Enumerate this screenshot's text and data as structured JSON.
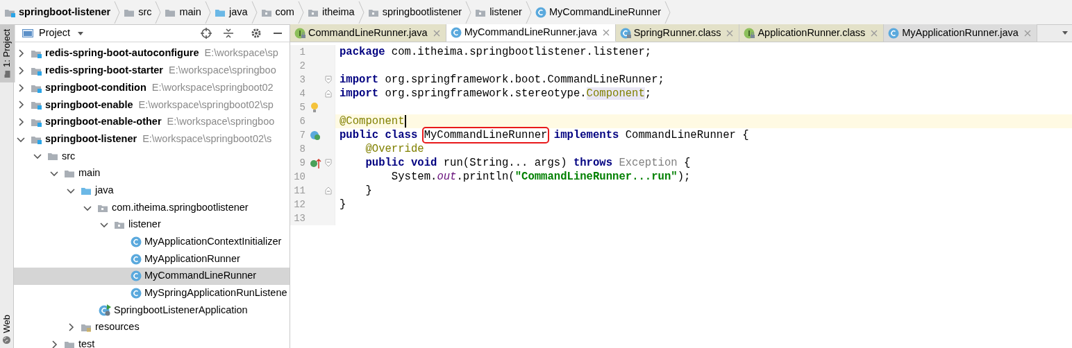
{
  "breadcrumbs": [
    {
      "label": "springboot-listener",
      "kind": "module"
    },
    {
      "label": "src",
      "kind": "folder"
    },
    {
      "label": "main",
      "kind": "folder"
    },
    {
      "label": "java",
      "kind": "source"
    },
    {
      "label": "com",
      "kind": "package"
    },
    {
      "label": "itheima",
      "kind": "package"
    },
    {
      "label": "springbootlistener",
      "kind": "package"
    },
    {
      "label": "listener",
      "kind": "package"
    },
    {
      "label": "MyCommandLineRunner",
      "kind": "class"
    }
  ],
  "side_strip": {
    "top_tab": {
      "label": "1: Project",
      "selected": true
    },
    "bottom_tab": {
      "label": "Web",
      "selected": false
    }
  },
  "project_panel": {
    "title": "Project",
    "tree": [
      {
        "label": "redis-spring-boot-autoconfigure",
        "path": "E:\\workspace\\sp",
        "kind": "module",
        "expanded": false,
        "selected": false
      },
      {
        "label": "redis-spring-boot-starter",
        "path": "E:\\workspace\\springboo",
        "kind": "module",
        "expanded": false,
        "selected": false
      },
      {
        "label": "springboot-condition",
        "path": "E:\\workspace\\springboot02",
        "kind": "module",
        "expanded": false,
        "selected": false
      },
      {
        "label": "springboot-enable",
        "path": "E:\\workspace\\springboot02\\sp",
        "kind": "module",
        "expanded": false,
        "selected": false
      },
      {
        "label": "springboot-enable-other",
        "path": "E:\\workspace\\springboo",
        "kind": "module",
        "expanded": false,
        "selected": false
      },
      {
        "label": "springboot-listener",
        "path": "E:\\workspace\\springboot02\\s",
        "kind": "module",
        "expanded": true,
        "selected": false,
        "children": [
          {
            "label": "src",
            "kind": "folder",
            "expanded": true,
            "selected": false,
            "children": [
              {
                "label": "main",
                "kind": "folder",
                "expanded": true,
                "selected": false,
                "children": [
                  {
                    "label": "java",
                    "kind": "source",
                    "expanded": true,
                    "selected": false,
                    "children": [
                      {
                        "label": "com.itheima.springbootlistener",
                        "kind": "package",
                        "expanded": true,
                        "selected": false,
                        "children": [
                          {
                            "label": "listener",
                            "kind": "package",
                            "expanded": true,
                            "selected": false,
                            "children": [
                              {
                                "label": "MyApplicationContextInitializer",
                                "kind": "class",
                                "selected": false
                              },
                              {
                                "label": "MyApplicationRunner",
                                "kind": "class",
                                "selected": false
                              },
                              {
                                "label": "MyCommandLineRunner",
                                "kind": "class",
                                "selected": true
                              },
                              {
                                "label": "MySpringApplicationRunListene",
                                "kind": "class",
                                "selected": false
                              }
                            ]
                          },
                          {
                            "label": "SpringbootListenerApplication",
                            "kind": "app",
                            "selected": false
                          }
                        ]
                      }
                    ]
                  },
                  {
                    "label": "resources",
                    "kind": "resources",
                    "expanded": false,
                    "selected": false
                  }
                ]
              },
              {
                "label": "test",
                "kind": "folder",
                "expanded": false,
                "selected": false
              }
            ]
          }
        ]
      }
    ]
  },
  "editor": {
    "tabs": [
      {
        "label": "CommandLineRunner.java",
        "kind": "interface",
        "library": true,
        "selected": false
      },
      {
        "label": "MyCommandLineRunner.java",
        "kind": "class",
        "library": false,
        "selected": true
      },
      {
        "label": "SpringRunner.class",
        "kind": "class",
        "library": true,
        "selected": false
      },
      {
        "label": "ApplicationRunner.class",
        "kind": "interface",
        "library": true,
        "selected": false
      },
      {
        "label": "MyApplicationRunner.java",
        "kind": "class",
        "library": false,
        "selected": false
      }
    ],
    "lines": [
      {
        "number": "1",
        "current": false,
        "tokens": [
          {
            "text": "package",
            "kind": "keyword"
          },
          {
            "text": " com.itheima.springbootlistener.listener;",
            "kind": "plain"
          }
        ]
      },
      {
        "number": "2",
        "current": false
      },
      {
        "number": "3",
        "current": false,
        "fold_mark": {
          "kind": "start"
        },
        "tokens": [
          {
            "text": "import",
            "kind": "keyword"
          },
          {
            "text": " org.springframework.boot.CommandLineRunner;",
            "kind": "plain"
          }
        ]
      },
      {
        "number": "4",
        "current": false,
        "fold_mark": {
          "kind": "end"
        },
        "tokens": [
          {
            "text": "import",
            "kind": "keyword"
          },
          {
            "text": " org.springframework.stereotype.",
            "kind": "plain"
          },
          {
            "text": "Component",
            "kind": "usage"
          },
          {
            "text": ";",
            "kind": "plain"
          }
        ]
      },
      {
        "number": "5",
        "current": false,
        "gutter_icon": {
          "kind": "bulb"
        }
      },
      {
        "number": "6",
        "current": true,
        "tokens": [
          {
            "text": "@Component",
            "kind": "annotation"
          }
        ]
      },
      {
        "number": "7",
        "current": false,
        "gutter_icon": {
          "kind": "implements"
        },
        "tokens": [
          {
            "text": "public class ",
            "kind": "keyword"
          },
          {
            "text": "MyCommandLineRunner",
            "kind": "boxed"
          },
          {
            "text": " implements",
            "kind": "keyword"
          },
          {
            "text": " CommandLineRunner {",
            "kind": "plain"
          }
        ]
      },
      {
        "number": "8",
        "current": false,
        "tokens": [
          {
            "text": "    @Override",
            "kind": "annotation"
          }
        ]
      },
      {
        "number": "9",
        "current": false,
        "gutter_icon": {
          "kind": "overrides"
        },
        "fold_mark": {
          "kind": "start"
        },
        "tokens": [
          {
            "text": "    public void",
            "kind": "keyword"
          },
          {
            "text": " run(String... args) ",
            "kind": "plain"
          },
          {
            "text": "throws ",
            "kind": "keyword"
          },
          {
            "text": "Exception",
            "kind": "muted"
          },
          {
            "text": " {",
            "kind": "plain"
          }
        ]
      },
      {
        "number": "10",
        "current": false,
        "tokens": [
          {
            "text": "        System.",
            "kind": "plain"
          },
          {
            "text": "out",
            "kind": "static"
          },
          {
            "text": ".println(",
            "kind": "plain"
          },
          {
            "text": "\"CommandLineRunner...run\"",
            "kind": "string"
          },
          {
            "text": ");",
            "kind": "plain"
          }
        ]
      },
      {
        "number": "11",
        "current": false,
        "fold_mark": {
          "kind": "end"
        },
        "tokens": [
          {
            "text": "    }",
            "kind": "plain"
          }
        ]
      },
      {
        "number": "12",
        "current": false,
        "tokens": [
          {
            "text": "}",
            "kind": "plain"
          }
        ]
      },
      {
        "number": "13",
        "current": false
      }
    ]
  }
}
